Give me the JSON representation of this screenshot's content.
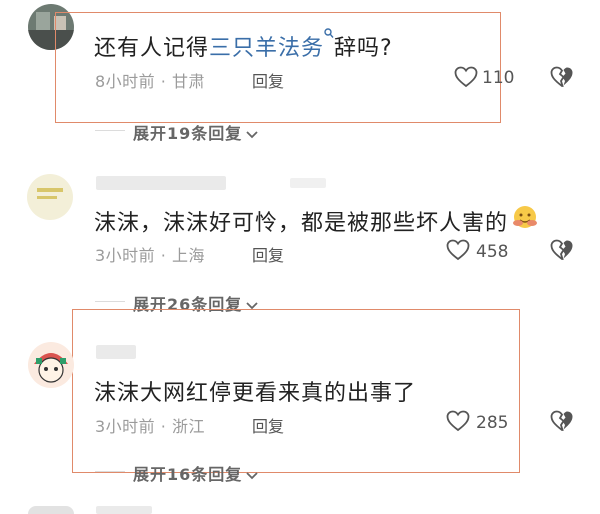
{
  "comments": [
    {
      "text_prefix": "还有人记得",
      "link_text": "三只羊法务",
      "text_suffix": "辞吗?",
      "time": "8小时前 · 甘肃",
      "reply_label": "回复",
      "likes": "110",
      "expand": "展开19条回复"
    },
    {
      "text": "沫沫，沫沫好可怜，都是被那些坏人害的",
      "time": "3小时前 · 上海",
      "reply_label": "回复",
      "likes": "458",
      "expand": "展开26条回复"
    },
    {
      "text": "沫沫大网红停更看来真的出事了",
      "time": "3小时前 · 浙江",
      "reply_label": "回复",
      "likes": "285",
      "expand": "展开16条回复"
    }
  ],
  "colors": {
    "highlight": "#e08a6a",
    "link": "#3a6ea8"
  },
  "icons": [
    "search-icon",
    "heart-icon",
    "broken-heart-icon",
    "chevron-down-icon",
    "hug-emoji"
  ]
}
